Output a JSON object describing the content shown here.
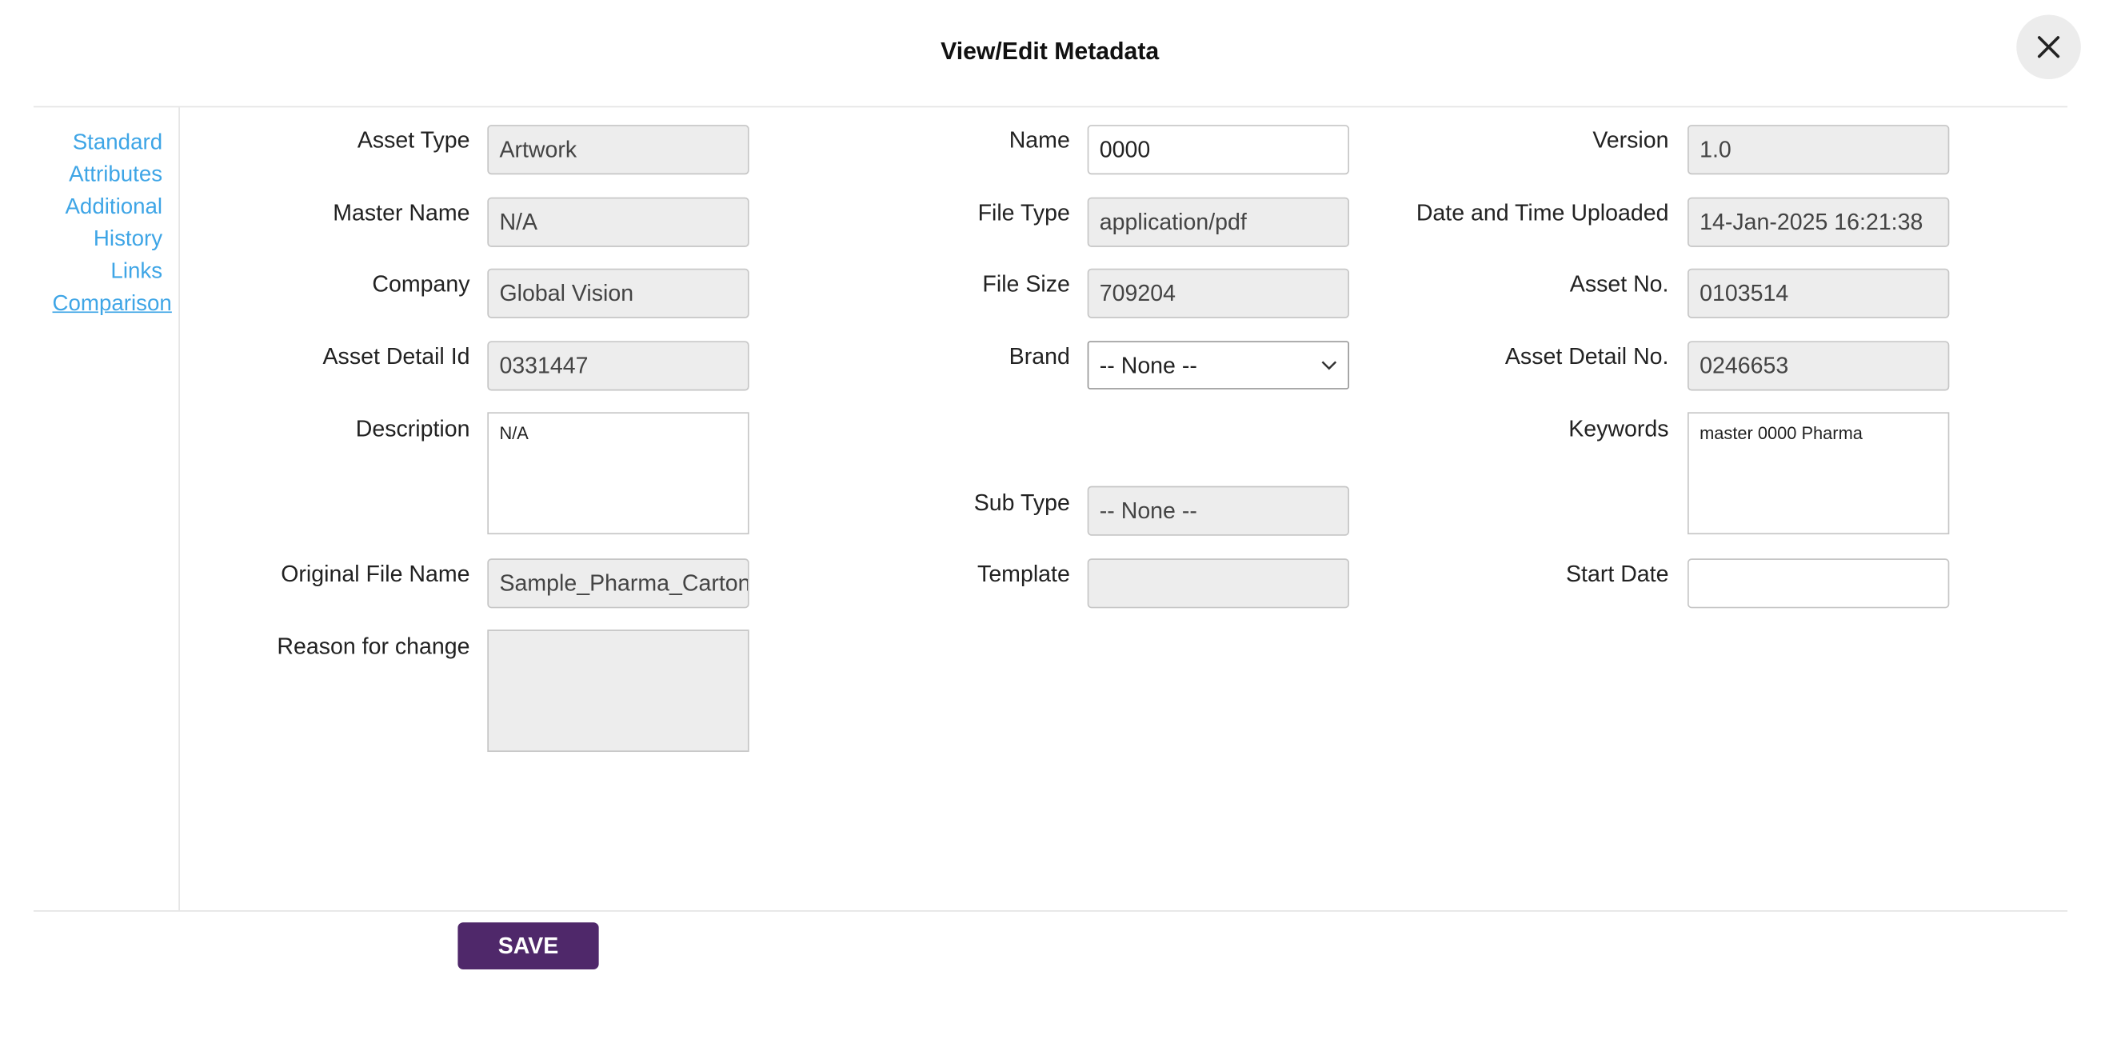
{
  "dialog": {
    "title": "View/Edit Metadata",
    "close_icon": "close-x-icon"
  },
  "sidebar": {
    "items": [
      {
        "label": "Standard"
      },
      {
        "label": "Attributes"
      },
      {
        "label": "Additional"
      },
      {
        "label": "History"
      },
      {
        "label": "Links"
      },
      {
        "label": "Comparison"
      }
    ]
  },
  "fields": {
    "asset_type": {
      "label": "Asset Type",
      "value": "Artwork"
    },
    "master_name": {
      "label": "Master Name",
      "value": "N/A"
    },
    "company": {
      "label": "Company",
      "value": "Global Vision"
    },
    "asset_detail_id": {
      "label": "Asset Detail Id",
      "value": "0331447"
    },
    "description": {
      "label": "Description",
      "value": "N/A"
    },
    "original_file_name": {
      "label": "Original File Name",
      "value": "Sample_Pharma_Carton"
    },
    "reason_for_change": {
      "label": "Reason for change",
      "value": ""
    },
    "name": {
      "label": "Name",
      "value": "0000"
    },
    "file_type": {
      "label": "File Type",
      "value": "application/pdf"
    },
    "file_size": {
      "label": "File Size",
      "value": "709204"
    },
    "brand": {
      "label": "Brand",
      "value": "-- None --"
    },
    "sub_type": {
      "label": "Sub Type",
      "value": "-- None --"
    },
    "template": {
      "label": "Template",
      "value": ""
    },
    "version": {
      "label": "Version",
      "value": "1.0"
    },
    "date_uploaded": {
      "label": "Date and Time Uploaded",
      "value": "14-Jan-2025 16:21:38"
    },
    "asset_no": {
      "label": "Asset No.",
      "value": "0103514"
    },
    "asset_detail_no": {
      "label": "Asset Detail No.",
      "value": "0246653"
    },
    "keywords": {
      "label": "Keywords",
      "value": "master 0000 Pharma"
    },
    "start_date": {
      "label": "Start Date",
      "value": ""
    }
  },
  "footer": {
    "save_label": "SAVE"
  },
  "colors": {
    "accent": "#4f286a",
    "link": "#3ea5e6",
    "readonly_bg": "#ededed"
  }
}
